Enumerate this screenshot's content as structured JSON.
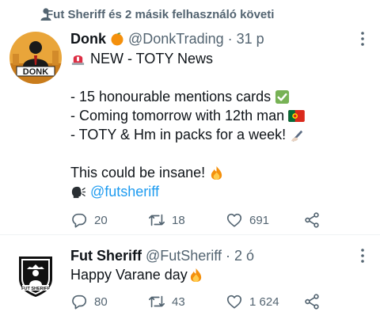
{
  "context": {
    "text": "Fut Sheriff és 2 másik felhasználó követi"
  },
  "tweets": [
    {
      "name": "Donk",
      "handle": "@DonkTrading",
      "dot": "·",
      "time": "31 p",
      "avatar_text": "DONK",
      "lines": [
        "NEW - TOTY News",
        "",
        "- 15 honourable mentions cards",
        "- Coming tomorrow with 12th man",
        "- TOTY & Hm in packs for a week!",
        "",
        "This could be insane!",
        "@futsheriff"
      ],
      "replies": "20",
      "retweets": "18",
      "likes": "691"
    },
    {
      "name": "Fut Sheriff",
      "handle": "@FutSheriff",
      "dot": "·",
      "time": "2 ó",
      "avatar_text": "FUT SHERIFF",
      "text": "Happy Varane day",
      "replies": "80",
      "retweets": "43",
      "likes": "1 624"
    }
  ],
  "colors": {
    "accent": "#1d9bf0",
    "muted": "#536471",
    "text": "#0f1419"
  }
}
